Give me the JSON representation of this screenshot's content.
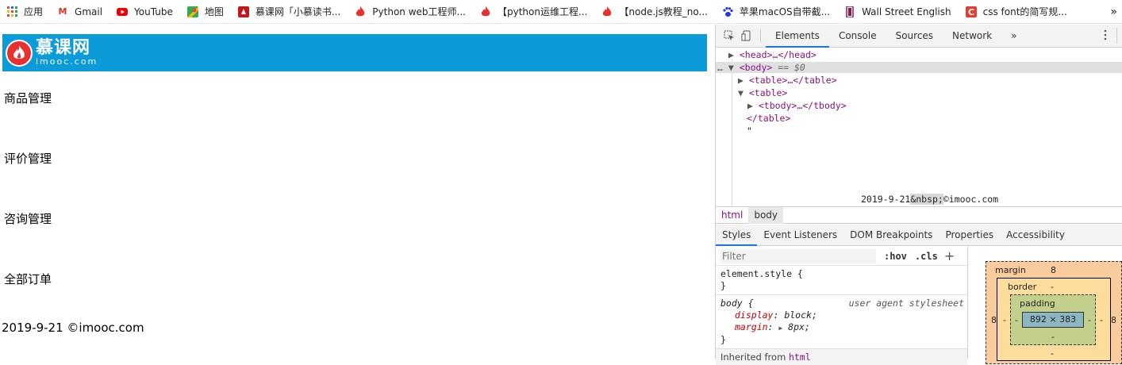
{
  "bookmarks": {
    "items": [
      {
        "label": "应用",
        "icon": "apps-grid-icon"
      },
      {
        "label": "Gmail",
        "icon": "gmail-icon"
      },
      {
        "label": "YouTube",
        "icon": "youtube-icon"
      },
      {
        "label": "地图",
        "icon": "maps-icon"
      },
      {
        "label": "慕课网「小慕读书...",
        "icon": "imooc-icon"
      },
      {
        "label": "Python web工程师...",
        "icon": "flame-icon"
      },
      {
        "label": "【python运维工程...",
        "icon": "flame-icon"
      },
      {
        "label": "【node.js教程_no...",
        "icon": "flame-icon"
      },
      {
        "label": "苹果macOS自带截...",
        "icon": "baidu-paw-icon"
      },
      {
        "label": "Wall Street English",
        "icon": "wse-icon"
      },
      {
        "label": "css font的简写规...",
        "icon": "csdn-icon"
      }
    ],
    "more": "»"
  },
  "page": {
    "logo_cn": "慕课网",
    "logo_en": "imooc.com",
    "menu": [
      "商品管理",
      "评价管理",
      "咨询管理",
      "全部订单"
    ],
    "footer": "2019-9-21 ©imooc.com"
  },
  "devtools": {
    "tabs": [
      "Elements",
      "Console",
      "Sources",
      "Network"
    ],
    "active_tab": "Elements",
    "more_tabs": "»",
    "dom": {
      "head": "<head>…</head>",
      "body_open": "<body>",
      "body_sel": "== $0",
      "table1": "<table>…</table>",
      "table2_open": "<table>",
      "tbody": "<tbody>…</tbody>",
      "table2_close": "</table>",
      "quote": "\"",
      "text_pre": "2019-9-21",
      "text_nbsp": "&nbsp;",
      "text_post": "©imooc.com"
    },
    "breadcrumbs": [
      "html",
      "body"
    ],
    "subtabs": [
      "Styles",
      "Event Listeners",
      "DOM Breakpoints",
      "Properties",
      "Accessibility"
    ],
    "active_subtab": "Styles",
    "filter_placeholder": "Filter",
    "hov": ":hov",
    "cls": ".cls",
    "plus": "+",
    "element_style": "element.style {",
    "close_brace": "}",
    "body_rule": {
      "selector": "body {",
      "source": "user agent stylesheet",
      "props": [
        {
          "name": "display",
          "value": "block;"
        },
        {
          "name": "margin",
          "value": "8px;"
        }
      ]
    },
    "inherited_label": "Inherited from",
    "inherited_tag": "html",
    "boxmodel": {
      "margin_label": "margin",
      "margin_value": "8",
      "border_label": "border",
      "border_value": "-",
      "padding_label": "padding",
      "padding_value": "-",
      "content": "892 × 383",
      "left": "8",
      "right": "8",
      "dash": "-"
    }
  }
}
